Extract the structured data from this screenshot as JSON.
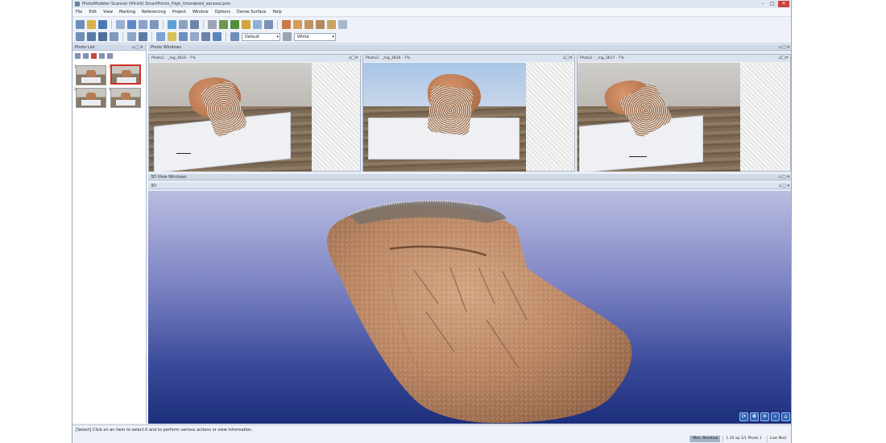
{
  "window": {
    "title": "PhotoModeler Scanner (64-bit) SmartPoints_High_Unordered_sqrsoso.pmr",
    "controls": [
      "–",
      "□",
      "✕"
    ]
  },
  "menu": [
    "File",
    "Edit",
    "View",
    "Marking",
    "Referencing",
    "Project",
    "Window",
    "Options",
    "Dense Surface",
    "Help"
  ],
  "toolbar": {
    "render_mode": "Default",
    "background": "White"
  },
  "photo_list": {
    "title": "Photo List",
    "thumbnails": [
      {
        "num": "1",
        "selected": false
      },
      {
        "num": "2",
        "selected": true
      },
      {
        "num": "3",
        "selected": false
      },
      {
        "num": "4",
        "selected": false
      }
    ]
  },
  "photo_windows": {
    "title": "Photo Windows",
    "windows": [
      {
        "title": "Photo1 : _mg_3616 - 7%"
      },
      {
        "title": "Photo3 : _mg_3618 - 7%"
      },
      {
        "title": "Photo1 : _mg_3617 - 7%"
      }
    ]
  },
  "view3d_windows": {
    "title": "3D View Windows",
    "view_title": "3D"
  },
  "panel_controls": "▫□✕",
  "status": {
    "message": "[Select] Click on an item to select it and to perform various actions or view information.",
    "cells": [
      "Max. Residual",
      "1.20 ap 1/1 Photo 1",
      "Last Mod"
    ]
  },
  "colors": {
    "sky_top": "#b9bde0",
    "sky_bottom": "#1c2f7a",
    "selection": "#d0302a"
  }
}
